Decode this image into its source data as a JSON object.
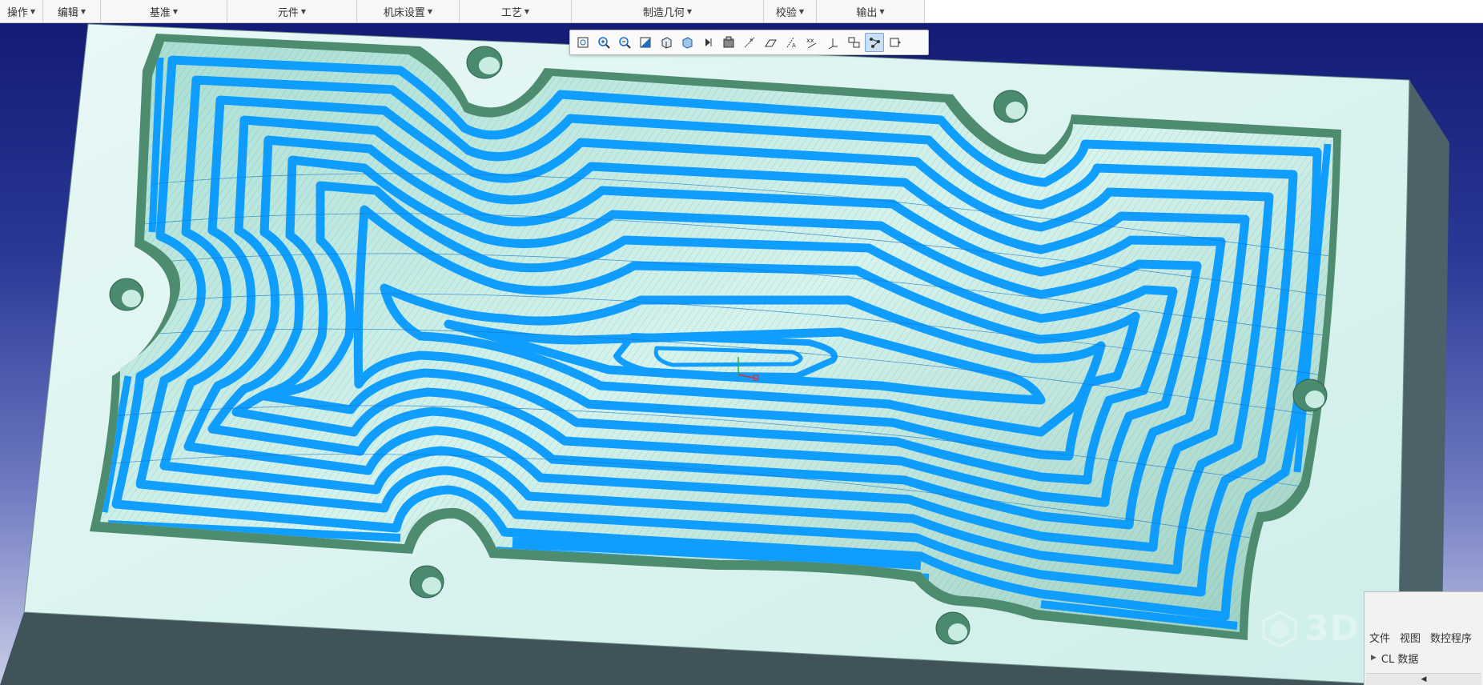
{
  "ribbon": {
    "groups": [
      {
        "label": "操作"
      },
      {
        "label": "编辑"
      },
      {
        "label": "基准"
      },
      {
        "label": "元件"
      },
      {
        "label": "机床设置"
      },
      {
        "label": "工艺"
      },
      {
        "label": "制造几何"
      },
      {
        "label": "校验"
      },
      {
        "label": "输出"
      }
    ]
  },
  "view_toolbar": {
    "icons": [
      "refit-icon",
      "zoom-in-icon",
      "zoom-out-icon",
      "repaint-icon",
      "display-style-icon",
      "saved-orientations-icon",
      "view-manager-icon",
      "perspective-icon",
      "datum-planes-icon",
      "datum-axes-icon",
      "datum-points-icon",
      "coordinate-systems-icon",
      "annotations-icon",
      "spin-center-icon",
      "cl-display-icon",
      "more-icon"
    ],
    "active_icon": "cl-display-icon"
  },
  "dock": {
    "tabs": [
      "文件",
      "视图",
      "数控程序"
    ],
    "tree_item": "CL 数据",
    "scroll_glyph": "◀"
  },
  "watermark": {
    "text": "3D",
    "small": ""
  },
  "colors": {
    "toolpath": "#0a9bff",
    "stock_top": "#dff4f4",
    "pocket_wall": "#4f8c72",
    "pocket_floor": "#bfe6dc",
    "block_side": "#4c5f66",
    "background_top": "#141b74",
    "background_bottom": "#c9cde8"
  }
}
